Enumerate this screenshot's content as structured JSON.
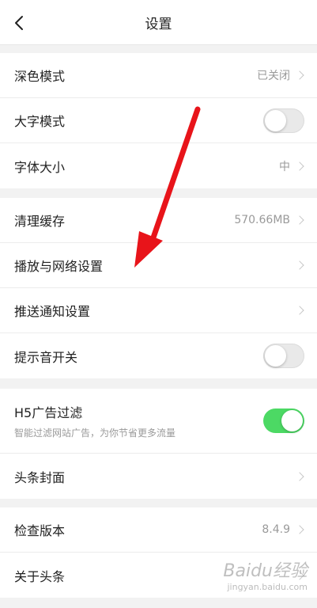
{
  "nav": {
    "title": "设置"
  },
  "group1": {
    "dark_mode": {
      "label": "深色模式",
      "value": "已关闭"
    },
    "large_text": {
      "label": "大字模式",
      "toggle_on": false
    },
    "font_size": {
      "label": "字体大小",
      "value": "中"
    }
  },
  "group2": {
    "clear_cache": {
      "label": "清理缓存",
      "value": "570.66MB"
    },
    "playback_network": {
      "label": "播放与网络设置"
    },
    "push_notifications": {
      "label": "推送通知设置"
    },
    "sound_toggle": {
      "label": "提示音开关",
      "toggle_on": false
    }
  },
  "group3": {
    "h5_ad_filter": {
      "label": "H5广告过滤",
      "subtitle": "智能过滤网站广告，为你节省更多流量",
      "toggle_on": true
    },
    "cover": {
      "label": "头条封面"
    }
  },
  "group4": {
    "check_version": {
      "label": "检查版本",
      "value": "8.4.9"
    },
    "about": {
      "label": "关于头条"
    }
  },
  "watermark": {
    "logo_text": "Baidu经验",
    "url": "jingyan.baidu.com"
  },
  "colors": {
    "toggle_on": "#4cd964",
    "arrow": "#e8141a"
  }
}
